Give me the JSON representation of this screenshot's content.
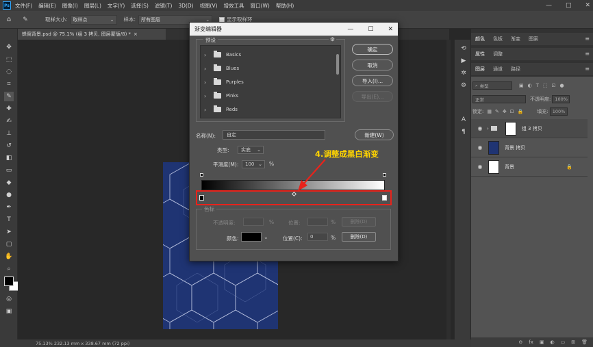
{
  "app": {
    "logo": "Ps",
    "menu": [
      "文件(F)",
      "编辑(E)",
      "图像(I)",
      "图层(L)",
      "文字(Y)",
      "选择(S)",
      "滤镜(T)",
      "3D(D)",
      "视图(V)",
      "增效工具",
      "窗口(W)",
      "帮助(H)"
    ],
    "window_controls": [
      "—",
      "□",
      "✕"
    ]
  },
  "options_bar": {
    "sample_size_label": "取样大小:",
    "sample_size_value": "取样点",
    "sample_label": "样本:",
    "sample_value": "所有图层",
    "show_ring_label": "显示取样环"
  },
  "document": {
    "tab_label": "蜂窝背景.psd @ 75.1% (组 3 拷贝, 图层蒙版/8) *",
    "tab_close": "×",
    "status": "75.13%    232.13 mm x 338.67 mm (72 ppi)",
    "artboard_color": "#1f3473"
  },
  "icons": {
    "strip": [
      "history-icon",
      "play-icon",
      "tools-icon",
      "adjust-icon",
      "text-icon",
      "paragraph-icon"
    ]
  },
  "right_panel": {
    "top_tabs": [
      "颜色",
      "色板",
      "渐变",
      "图案"
    ],
    "mid_tabs": [
      "属性",
      "调整"
    ],
    "layer_tabs": [
      "图层",
      "通道",
      "路径"
    ],
    "filter_label": "类型",
    "blend_mode": "正常",
    "opacity_label": "不透明度:",
    "opacity_value": "100%",
    "lock_label": "锁定:",
    "fill_label": "填充:",
    "fill_value": "100%",
    "layers": [
      {
        "name": "组 3 拷贝",
        "selected": true,
        "thumb": "#ffffff",
        "lock": ""
      },
      {
        "name": "背景 拷贝",
        "selected": false,
        "thumb": "#1f3473",
        "lock": ""
      },
      {
        "name": "背景",
        "selected": false,
        "thumb": "#ffffff",
        "lock": "🔒"
      }
    ],
    "footer_icons": [
      "link-icon",
      "fx-icon",
      "mask-icon",
      "adjustment-icon",
      "folder-icon",
      "new-layer-icon",
      "trash-icon"
    ],
    "footer_glyphs": [
      "⊖",
      "fx",
      "▣",
      "◐",
      "▭",
      "⊞",
      "🗑"
    ]
  },
  "dialog": {
    "title": "渐变编辑器",
    "ctrls": [
      "—",
      "☐",
      "✕"
    ],
    "presets_label": "预设",
    "presets": [
      "Basics",
      "Blues",
      "Purples",
      "Pinks",
      "Reds"
    ],
    "ok_label": "确定",
    "cancel_label": "取消",
    "import_label": "导入(I)...",
    "export_label": "导出(E)...",
    "name_label": "名称(N):",
    "name_value": "自定",
    "new_label": "新建(W)",
    "type_label": "类型:",
    "type_value": "实底",
    "smooth_label": "平滑度(M):",
    "smooth_value": "100",
    "smooth_unit": "%",
    "stops_label": "色标",
    "opacity_label": "不透明度:",
    "opacity_unit": "%",
    "location_label": "位置:",
    "location_unit": "%",
    "delete_label": "删除(D)",
    "color_label": "颜色:",
    "color_location_label": "位置(C):",
    "color_location_value": "0",
    "color_delete_label": "删除(D)",
    "gradient_start": "#000000",
    "gradient_end": "#ffffff"
  },
  "annotation": {
    "text": "4.调整成黑白渐变",
    "text_color": "#ffd400",
    "highlight_color": "#e8231b"
  }
}
